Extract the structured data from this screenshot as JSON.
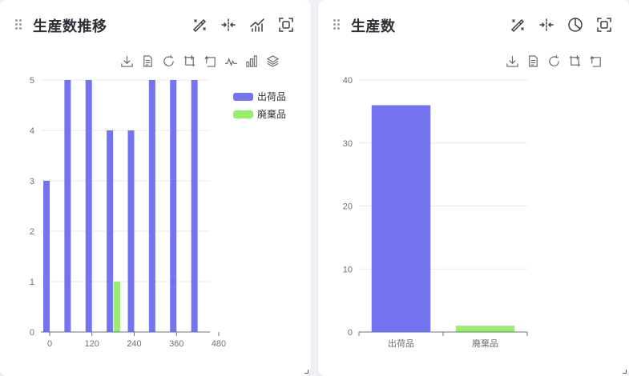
{
  "left_panel": {
    "title": "生産数推移",
    "header_icons": [
      "magic-wand-icon",
      "split-arrows-icon",
      "line-chart-icon",
      "fullscreen-icon"
    ],
    "toolbox_icons": [
      "download-icon",
      "data-view-icon",
      "restore-icon",
      "zoom-icon",
      "zoom-reset-icon",
      "line-switch-icon",
      "bar-switch-icon",
      "stack-icon"
    ]
  },
  "right_panel": {
    "title": "生産数",
    "header_icons": [
      "magic-wand-icon",
      "split-arrows-icon",
      "pie-chart-icon",
      "fullscreen-icon"
    ],
    "toolbox_icons": [
      "download-icon",
      "data-view-icon",
      "restore-icon",
      "zoom-icon",
      "zoom-reset-icon"
    ]
  },
  "colors": {
    "series1": "#7474f0",
    "series2": "#96ee6e",
    "grid": "#e6e8ee",
    "axis": "#6e7079"
  },
  "chart_data": [
    {
      "type": "bar",
      "x_axis": "value",
      "xlim": [
        0,
        480
      ],
      "xticks": [
        "0",
        "120",
        "240",
        "360",
        "480"
      ],
      "ylim": [
        0,
        5
      ],
      "yticks": [
        "0",
        "1",
        "2",
        "3",
        "4",
        "5"
      ],
      "legend": [
        "出荷品",
        "廃棄品"
      ],
      "legend_position": "top-right",
      "series": [
        {
          "name": "出荷品",
          "color": "#7474f0",
          "points": [
            [
              0,
              3
            ],
            [
              60,
              5
            ],
            [
              120,
              5
            ],
            [
              180,
              4
            ],
            [
              240,
              4
            ],
            [
              300,
              5
            ],
            [
              360,
              5
            ],
            [
              420,
              5
            ]
          ]
        },
        {
          "name": "廃棄品",
          "color": "#96ee6e",
          "points": [
            [
              180,
              1
            ]
          ]
        }
      ]
    },
    {
      "type": "bar",
      "categories": [
        "出荷品",
        "廃棄品"
      ],
      "values": [
        36,
        1
      ],
      "colors": [
        "#7474f0",
        "#96ee6e"
      ],
      "ylim": [
        0,
        40
      ],
      "yticks": [
        "0",
        "10",
        "20",
        "30",
        "40"
      ]
    }
  ]
}
